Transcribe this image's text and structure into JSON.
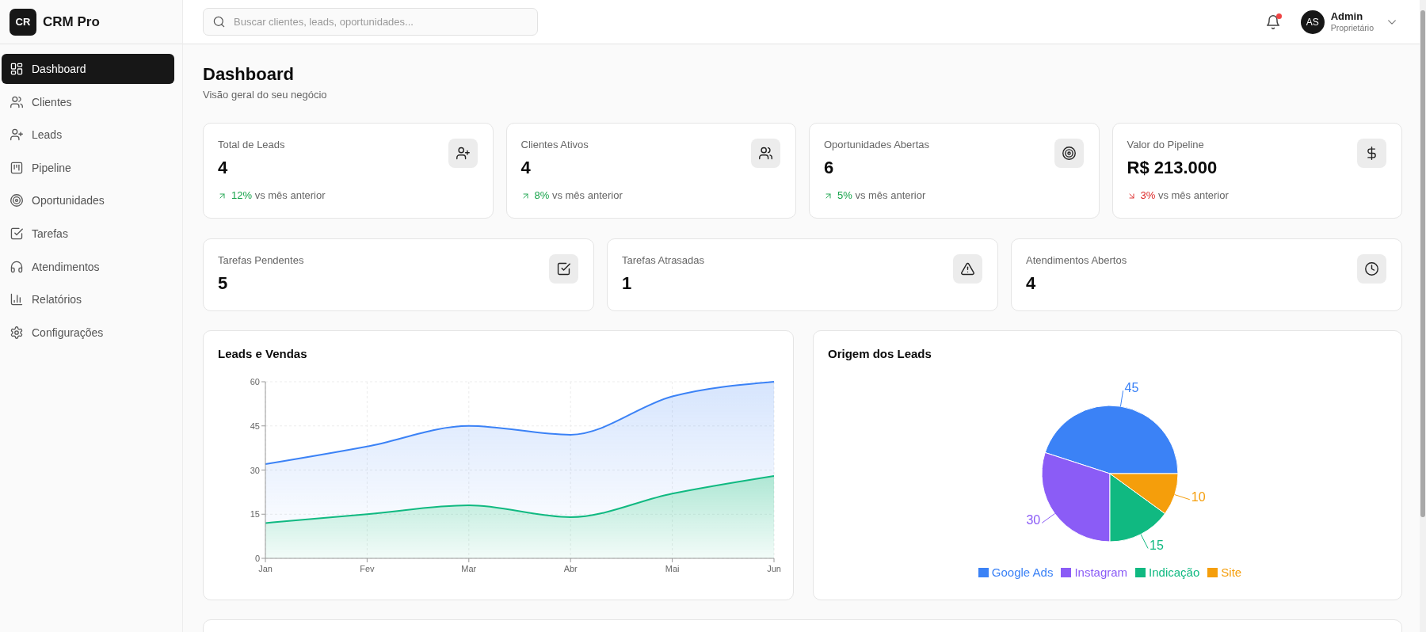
{
  "app": {
    "logo": "CR",
    "name": "CRM Pro"
  },
  "sidebar": {
    "items": [
      {
        "label": "Dashboard",
        "selected": true
      },
      {
        "label": "Clientes",
        "selected": false
      },
      {
        "label": "Leads",
        "selected": false
      },
      {
        "label": "Pipeline",
        "selected": false
      },
      {
        "label": "Oportunidades",
        "selected": false
      },
      {
        "label": "Tarefas",
        "selected": false
      },
      {
        "label": "Atendimentos",
        "selected": false
      },
      {
        "label": "Relatórios",
        "selected": false
      },
      {
        "label": "Configurações",
        "selected": false
      }
    ]
  },
  "header": {
    "search": {
      "placeholder": "Buscar clientes, leads, oportunidades..."
    },
    "notifications": {
      "unread": true
    },
    "user": {
      "initials": "AS",
      "name": "Admin",
      "role": "Proprietário"
    }
  },
  "page": {
    "title": "Dashboard",
    "subtitle": "Visão geral do seu negócio"
  },
  "stats": [
    {
      "label": "Total de Leads",
      "value": "4",
      "trend": {
        "rising": true,
        "change": "12%",
        "text": "vs mês anterior"
      }
    },
    {
      "label": "Clientes Ativos",
      "value": "4",
      "trend": {
        "rising": true,
        "change": "8%",
        "text": "vs mês anterior"
      }
    },
    {
      "label": "Oportunidades Abertas",
      "value": "6",
      "trend": {
        "rising": true,
        "change": "5%",
        "text": "vs mês anterior"
      }
    },
    {
      "label": "Valor do Pipeline",
      "value": "R$ 213.000",
      "trend": {
        "rising": false,
        "change": "3%",
        "text": "vs mês anterior"
      }
    }
  ],
  "task_stats": [
    {
      "label": "Tarefas Pendentes",
      "value": "5"
    },
    {
      "label": "Tarefas Atrasadas",
      "value": "1"
    },
    {
      "label": "Atendimentos Abertos",
      "value": "4"
    }
  ],
  "charts": [
    {
      "chart_data": {
        "type": "area",
        "title": "Leads e Vendas",
        "categories": [
          "Jan",
          "Fev",
          "Mar",
          "Abr",
          "Mai",
          "Jun"
        ],
        "series": [
          {
            "color": "#3b82f6",
            "values": [
              32,
              38,
              45,
              42,
              55,
              60
            ]
          },
          {
            "color": "#10b981",
            "values": [
              12,
              15,
              18,
              14,
              22,
              28
            ]
          }
        ],
        "ylim": [
          0,
          60
        ],
        "yticks": [
          0,
          15,
          30,
          45,
          60
        ],
        "grid": true
      }
    },
    {
      "chart_data": {
        "type": "pie",
        "title": "Origem dos Leads",
        "categories": [
          "Google Ads",
          "Instagram",
          "Indicação",
          "Site"
        ],
        "values": [
          45,
          30,
          15,
          10
        ],
        "colors": [
          "#3b82f6",
          "#8b5cf6",
          "#10b981",
          "#f59e0b"
        ],
        "data_labels": true,
        "legend": "bottom"
      }
    }
  ]
}
